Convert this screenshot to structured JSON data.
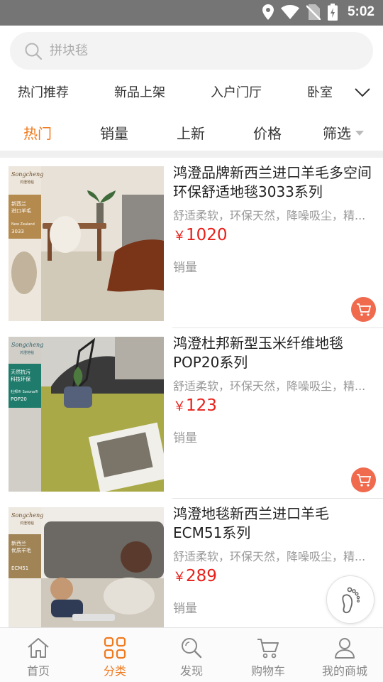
{
  "status_bar": {
    "time": "5:02"
  },
  "search": {
    "placeholder": "拼块毯"
  },
  "category_tabs": [
    "热门推荐",
    "新品上架",
    "入户门厅",
    "卧室"
  ],
  "sort_tabs": [
    "热门",
    "销量",
    "上新",
    "价格",
    "筛选"
  ],
  "sort_active_index": 0,
  "products": [
    {
      "title": "鸿澄品牌新西兰进口羊毛多空间环保舒适地毯3033系列",
      "desc": "舒适柔软，环保天然，降噪吸尘，精...",
      "currency": "￥",
      "price": "1020",
      "sales_label": "销量",
      "image": {
        "brand": "Songcheng",
        "brand_cn": "鸿澄地毯",
        "tag_line1": "新西兰",
        "tag_line2": "进口羊毛",
        "series_en": "New Zealand",
        "series": "3033"
      }
    },
    {
      "title": "鸿澄杜邦新型玉米纤维地毯POP20系列",
      "desc": "舒适柔软，环保天然，降噪吸尘，精...",
      "currency": "￥",
      "price": "123",
      "sales_label": "销量",
      "image": {
        "brand": "Songcheng",
        "brand_cn": "鸿澄地毯",
        "tag_line1": "天然抗污",
        "tag_line2": "科技环保",
        "series_en": "杜邦® Sorona®",
        "series": "POP20"
      }
    },
    {
      "title": "鸿澄地毯新西兰进口羊毛ECM51系列",
      "desc": "舒适柔软，环保天然，降噪吸尘，精...",
      "currency": "￥",
      "price": "289",
      "sales_label": "销量",
      "image": {
        "brand": "Songcheng",
        "brand_cn": "鸿澄地毯",
        "tag_line1": "新西兰",
        "tag_line2": "优质羊毛",
        "series_en": "",
        "series": "ECM51"
      }
    }
  ],
  "bottom_nav": [
    {
      "label": "首页",
      "icon": "home-icon"
    },
    {
      "label": "分类",
      "icon": "category-icon"
    },
    {
      "label": "发现",
      "icon": "discover-icon"
    },
    {
      "label": "购物车",
      "icon": "cart-icon"
    },
    {
      "label": "我的商城",
      "icon": "user-icon"
    }
  ],
  "bottom_nav_active_index": 1,
  "colors": {
    "accent": "#f07a1e",
    "price": "#e8201a",
    "cart": "#f06a4e",
    "status_bar": "#757575"
  }
}
